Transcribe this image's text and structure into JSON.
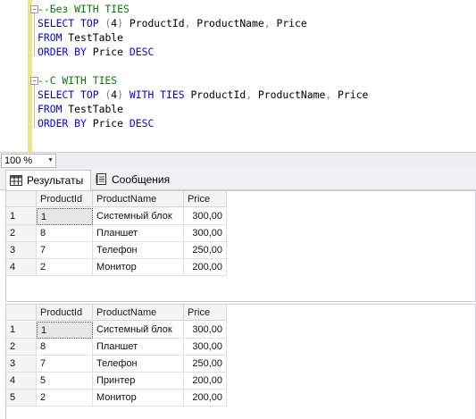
{
  "editor": {
    "lines": [
      {
        "parts": [
          {
            "t": "--Без WITH TIES",
            "c": "cm"
          }
        ]
      },
      {
        "parts": [
          {
            "t": "SELECT TOP ",
            "c": "kw"
          },
          {
            "t": "(",
            "c": "gy"
          },
          {
            "t": "4",
            "c": ""
          },
          {
            "t": ")",
            "c": "gy"
          },
          {
            "t": " ProductId",
            "c": ""
          },
          {
            "t": ",",
            "c": "gy"
          },
          {
            "t": " ProductName",
            "c": ""
          },
          {
            "t": ",",
            "c": "gy"
          },
          {
            "t": " Price",
            "c": ""
          }
        ]
      },
      {
        "parts": [
          {
            "t": "FROM ",
            "c": "kw"
          },
          {
            "t": "TestTable",
            "c": ""
          }
        ]
      },
      {
        "parts": [
          {
            "t": "ORDER BY ",
            "c": "kw"
          },
          {
            "t": "Price ",
            "c": ""
          },
          {
            "t": "DESC",
            "c": "kw"
          }
        ]
      },
      {
        "parts": []
      },
      {
        "parts": [
          {
            "t": "--С WITH TIES",
            "c": "cm"
          }
        ]
      },
      {
        "parts": [
          {
            "t": "SELECT TOP ",
            "c": "kw"
          },
          {
            "t": "(",
            "c": "gy"
          },
          {
            "t": "4",
            "c": ""
          },
          {
            "t": ")",
            "c": "gy"
          },
          {
            "t": " WITH TIES ",
            "c": "kw"
          },
          {
            "t": "ProductId",
            "c": ""
          },
          {
            "t": ",",
            "c": "gy"
          },
          {
            "t": " ProductName",
            "c": ""
          },
          {
            "t": ",",
            "c": "gy"
          },
          {
            "t": " Price",
            "c": ""
          }
        ]
      },
      {
        "parts": [
          {
            "t": "FROM ",
            "c": "kw"
          },
          {
            "t": "TestTable",
            "c": ""
          }
        ]
      },
      {
        "parts": [
          {
            "t": "ORDER BY ",
            "c": "kw"
          },
          {
            "t": "Price ",
            "c": ""
          },
          {
            "t": "DESC",
            "c": "kw"
          }
        ]
      }
    ],
    "fold_glyph": "−"
  },
  "zoom": {
    "value": "100 %"
  },
  "tabs": [
    {
      "label": "Результаты",
      "icon": "grid-icon",
      "active": true
    },
    {
      "label": "Сообщения",
      "icon": "messages-icon",
      "active": false
    }
  ],
  "results": [
    {
      "columns": [
        "ProductId",
        "ProductName",
        "Price"
      ],
      "rows": [
        {
          "n": "1",
          "ProductId": "1",
          "ProductName": "Системный блок",
          "Price": "300,00"
        },
        {
          "n": "2",
          "ProductId": "8",
          "ProductName": "Планшет",
          "Price": "300,00"
        },
        {
          "n": "3",
          "ProductId": "7",
          "ProductName": "Телефон",
          "Price": "250,00"
        },
        {
          "n": "4",
          "ProductId": "2",
          "ProductName": "Монитор",
          "Price": "200,00"
        }
      ]
    },
    {
      "columns": [
        "ProductId",
        "ProductName",
        "Price"
      ],
      "rows": [
        {
          "n": "1",
          "ProductId": "1",
          "ProductName": "Системный блок",
          "Price": "300,00"
        },
        {
          "n": "2",
          "ProductId": "8",
          "ProductName": "Планшет",
          "Price": "300,00"
        },
        {
          "n": "3",
          "ProductId": "7",
          "ProductName": "Телефон",
          "Price": "250,00"
        },
        {
          "n": "4",
          "ProductId": "5",
          "ProductName": "Принтер",
          "Price": "200,00"
        },
        {
          "n": "5",
          "ProductId": "2",
          "ProductName": "Монитор",
          "Price": "200,00"
        }
      ]
    }
  ],
  "colors": {
    "keyword": "#0000ff",
    "comment": "#008000",
    "gutter_change_bar": "#ece58c"
  }
}
